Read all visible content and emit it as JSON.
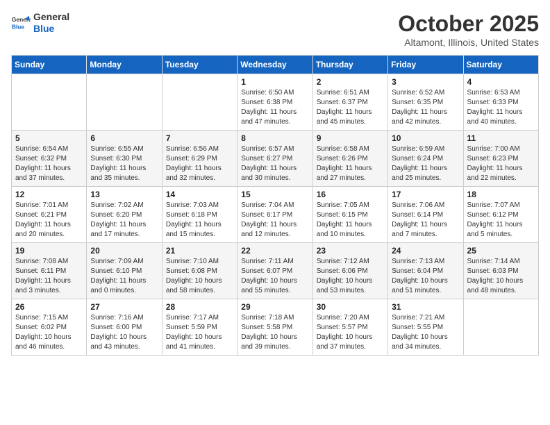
{
  "header": {
    "logo_general": "General",
    "logo_blue": "Blue",
    "title": "October 2025",
    "subtitle": "Altamont, Illinois, United States"
  },
  "weekdays": [
    "Sunday",
    "Monday",
    "Tuesday",
    "Wednesday",
    "Thursday",
    "Friday",
    "Saturday"
  ],
  "weeks": [
    [
      {
        "day": "",
        "info": ""
      },
      {
        "day": "",
        "info": ""
      },
      {
        "day": "",
        "info": ""
      },
      {
        "day": "1",
        "info": "Sunrise: 6:50 AM\nSunset: 6:38 PM\nDaylight: 11 hours\nand 47 minutes."
      },
      {
        "day": "2",
        "info": "Sunrise: 6:51 AM\nSunset: 6:37 PM\nDaylight: 11 hours\nand 45 minutes."
      },
      {
        "day": "3",
        "info": "Sunrise: 6:52 AM\nSunset: 6:35 PM\nDaylight: 11 hours\nand 42 minutes."
      },
      {
        "day": "4",
        "info": "Sunrise: 6:53 AM\nSunset: 6:33 PM\nDaylight: 11 hours\nand 40 minutes."
      }
    ],
    [
      {
        "day": "5",
        "info": "Sunrise: 6:54 AM\nSunset: 6:32 PM\nDaylight: 11 hours\nand 37 minutes."
      },
      {
        "day": "6",
        "info": "Sunrise: 6:55 AM\nSunset: 6:30 PM\nDaylight: 11 hours\nand 35 minutes."
      },
      {
        "day": "7",
        "info": "Sunrise: 6:56 AM\nSunset: 6:29 PM\nDaylight: 11 hours\nand 32 minutes."
      },
      {
        "day": "8",
        "info": "Sunrise: 6:57 AM\nSunset: 6:27 PM\nDaylight: 11 hours\nand 30 minutes."
      },
      {
        "day": "9",
        "info": "Sunrise: 6:58 AM\nSunset: 6:26 PM\nDaylight: 11 hours\nand 27 minutes."
      },
      {
        "day": "10",
        "info": "Sunrise: 6:59 AM\nSunset: 6:24 PM\nDaylight: 11 hours\nand 25 minutes."
      },
      {
        "day": "11",
        "info": "Sunrise: 7:00 AM\nSunset: 6:23 PM\nDaylight: 11 hours\nand 22 minutes."
      }
    ],
    [
      {
        "day": "12",
        "info": "Sunrise: 7:01 AM\nSunset: 6:21 PM\nDaylight: 11 hours\nand 20 minutes."
      },
      {
        "day": "13",
        "info": "Sunrise: 7:02 AM\nSunset: 6:20 PM\nDaylight: 11 hours\nand 17 minutes."
      },
      {
        "day": "14",
        "info": "Sunrise: 7:03 AM\nSunset: 6:18 PM\nDaylight: 11 hours\nand 15 minutes."
      },
      {
        "day": "15",
        "info": "Sunrise: 7:04 AM\nSunset: 6:17 PM\nDaylight: 11 hours\nand 12 minutes."
      },
      {
        "day": "16",
        "info": "Sunrise: 7:05 AM\nSunset: 6:15 PM\nDaylight: 11 hours\nand 10 minutes."
      },
      {
        "day": "17",
        "info": "Sunrise: 7:06 AM\nSunset: 6:14 PM\nDaylight: 11 hours\nand 7 minutes."
      },
      {
        "day": "18",
        "info": "Sunrise: 7:07 AM\nSunset: 6:12 PM\nDaylight: 11 hours\nand 5 minutes."
      }
    ],
    [
      {
        "day": "19",
        "info": "Sunrise: 7:08 AM\nSunset: 6:11 PM\nDaylight: 11 hours\nand 3 minutes."
      },
      {
        "day": "20",
        "info": "Sunrise: 7:09 AM\nSunset: 6:10 PM\nDaylight: 11 hours\nand 0 minutes."
      },
      {
        "day": "21",
        "info": "Sunrise: 7:10 AM\nSunset: 6:08 PM\nDaylight: 10 hours\nand 58 minutes."
      },
      {
        "day": "22",
        "info": "Sunrise: 7:11 AM\nSunset: 6:07 PM\nDaylight: 10 hours\nand 55 minutes."
      },
      {
        "day": "23",
        "info": "Sunrise: 7:12 AM\nSunset: 6:06 PM\nDaylight: 10 hours\nand 53 minutes."
      },
      {
        "day": "24",
        "info": "Sunrise: 7:13 AM\nSunset: 6:04 PM\nDaylight: 10 hours\nand 51 minutes."
      },
      {
        "day": "25",
        "info": "Sunrise: 7:14 AM\nSunset: 6:03 PM\nDaylight: 10 hours\nand 48 minutes."
      }
    ],
    [
      {
        "day": "26",
        "info": "Sunrise: 7:15 AM\nSunset: 6:02 PM\nDaylight: 10 hours\nand 46 minutes."
      },
      {
        "day": "27",
        "info": "Sunrise: 7:16 AM\nSunset: 6:00 PM\nDaylight: 10 hours\nand 43 minutes."
      },
      {
        "day": "28",
        "info": "Sunrise: 7:17 AM\nSunset: 5:59 PM\nDaylight: 10 hours\nand 41 minutes."
      },
      {
        "day": "29",
        "info": "Sunrise: 7:18 AM\nSunset: 5:58 PM\nDaylight: 10 hours\nand 39 minutes."
      },
      {
        "day": "30",
        "info": "Sunrise: 7:20 AM\nSunset: 5:57 PM\nDaylight: 10 hours\nand 37 minutes."
      },
      {
        "day": "31",
        "info": "Sunrise: 7:21 AM\nSunset: 5:55 PM\nDaylight: 10 hours\nand 34 minutes."
      },
      {
        "day": "",
        "info": ""
      }
    ]
  ]
}
